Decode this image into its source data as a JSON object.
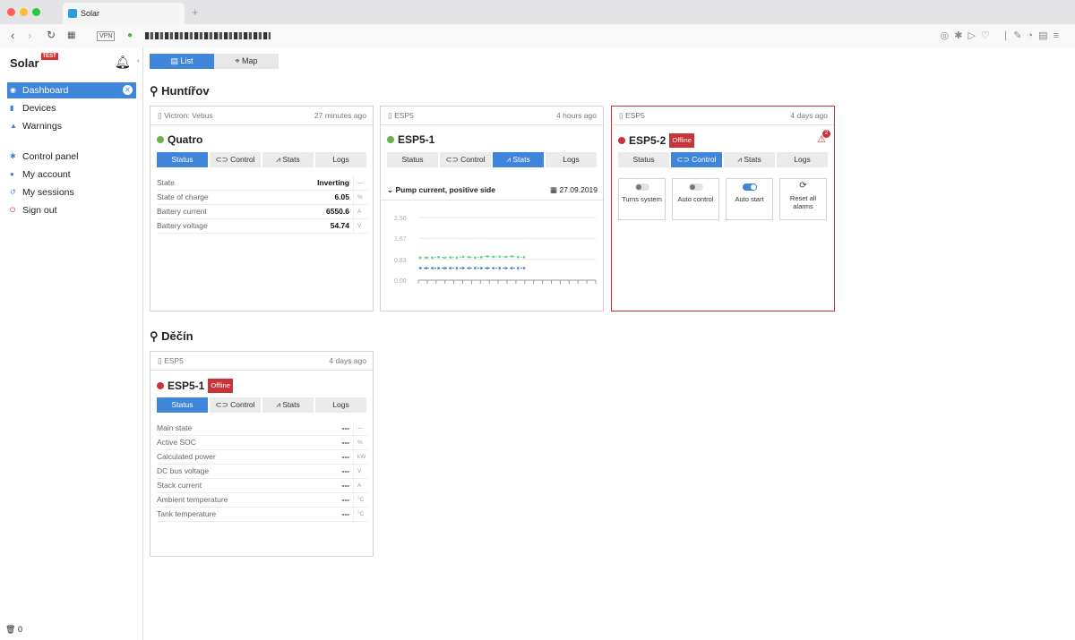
{
  "browser": {
    "tab_title": "Solar",
    "vpn_label": "VPN"
  },
  "sidebar": {
    "brand": "Solar",
    "brand_badge": "TEST",
    "items": [
      {
        "label": "Dashboard",
        "icon": "dashboard-icon"
      },
      {
        "label": "Devices",
        "icon": "device-icon"
      },
      {
        "label": "Warnings",
        "icon": "bell-icon"
      },
      {
        "label": "Control panel",
        "icon": "gear-icon"
      },
      {
        "label": "My account",
        "icon": "user-icon"
      },
      {
        "label": "My sessions",
        "icon": "history-icon"
      },
      {
        "label": "Sign out",
        "icon": "power-icon"
      }
    ],
    "footer_count": "0"
  },
  "view_tabs": {
    "list": "List",
    "map": "Map"
  },
  "locations": [
    {
      "name": "Huntířov"
    },
    {
      "name": "Děčín"
    }
  ],
  "tabs": {
    "status": "Status",
    "control": "Control",
    "stats": "Stats",
    "logs": "Logs"
  },
  "cards": {
    "quatro": {
      "source": "Victron: Vebus",
      "ago": "27 minutes ago",
      "title": "Quatro",
      "online": true,
      "rows": [
        {
          "label": "State",
          "value": "Inverting",
          "unit": "---"
        },
        {
          "label": "State of charge",
          "value": "6.05",
          "unit": "%"
        },
        {
          "label": "Battery current",
          "value": "6550.6",
          "unit": "A"
        },
        {
          "label": "Battery voltage",
          "value": "54.74",
          "unit": "V"
        }
      ]
    },
    "esp5_1_hunt": {
      "source": "ESP5",
      "ago": "4 hours ago",
      "title": "ESP5-1",
      "online": true,
      "stat_title": "Pump current, positive side",
      "stat_date": "27.09.2019",
      "chart_data": {
        "type": "line",
        "ylim": [
          0,
          2.5
        ],
        "yticks": [
          "2.50",
          "1.67",
          "0.83",
          "0.00"
        ],
        "series": [
          {
            "color": "#6ad08a",
            "values": [
              0.9,
              0.9,
              0.9,
              0.92,
              0.9,
              0.91,
              0.9,
              0.93,
              0.92,
              0.9,
              0.92,
              0.95,
              0.93,
              0.94,
              0.93,
              0.95,
              0.92,
              0.92
            ]
          },
          {
            "color": "#4a7fe0",
            "values": [
              0.48,
              0.48,
              0.48,
              0.48,
              0.48,
              0.48,
              0.48,
              0.48,
              0.48,
              0.48,
              0.48,
              0.48,
              0.48,
              0.48,
              0.48,
              0.48,
              0.48,
              0.48
            ]
          }
        ]
      }
    },
    "esp5_2": {
      "source": "ESP5",
      "ago": "4 days ago",
      "title": "ESP5-2",
      "badge": "Offline",
      "alarm_count": "2",
      "controls": [
        {
          "label": "Turns system",
          "type": "toggle",
          "on": false
        },
        {
          "label": "Auto control",
          "type": "toggle",
          "on": false
        },
        {
          "label": "Auto start",
          "type": "toggle",
          "on": true
        },
        {
          "label": "Reset all alarms",
          "type": "button"
        }
      ]
    },
    "esp5_1_decin": {
      "source": "ESP5",
      "ago": "4 days ago",
      "title": "ESP5-1",
      "badge": "Offline",
      "rows": [
        {
          "label": "Main state",
          "value": "---",
          "unit": "---"
        },
        {
          "label": "Active SOC",
          "value": "---",
          "unit": "%"
        },
        {
          "label": "Calculated power",
          "value": "---",
          "unit": "kW"
        },
        {
          "label": "DC bus voltage",
          "value": "---",
          "unit": "V"
        },
        {
          "label": "Stack current",
          "value": "---",
          "unit": "A"
        },
        {
          "label": "Ambient temperature",
          "value": "---",
          "unit": "°C"
        },
        {
          "label": "Tank temperature",
          "value": "---",
          "unit": "°C"
        }
      ]
    }
  }
}
